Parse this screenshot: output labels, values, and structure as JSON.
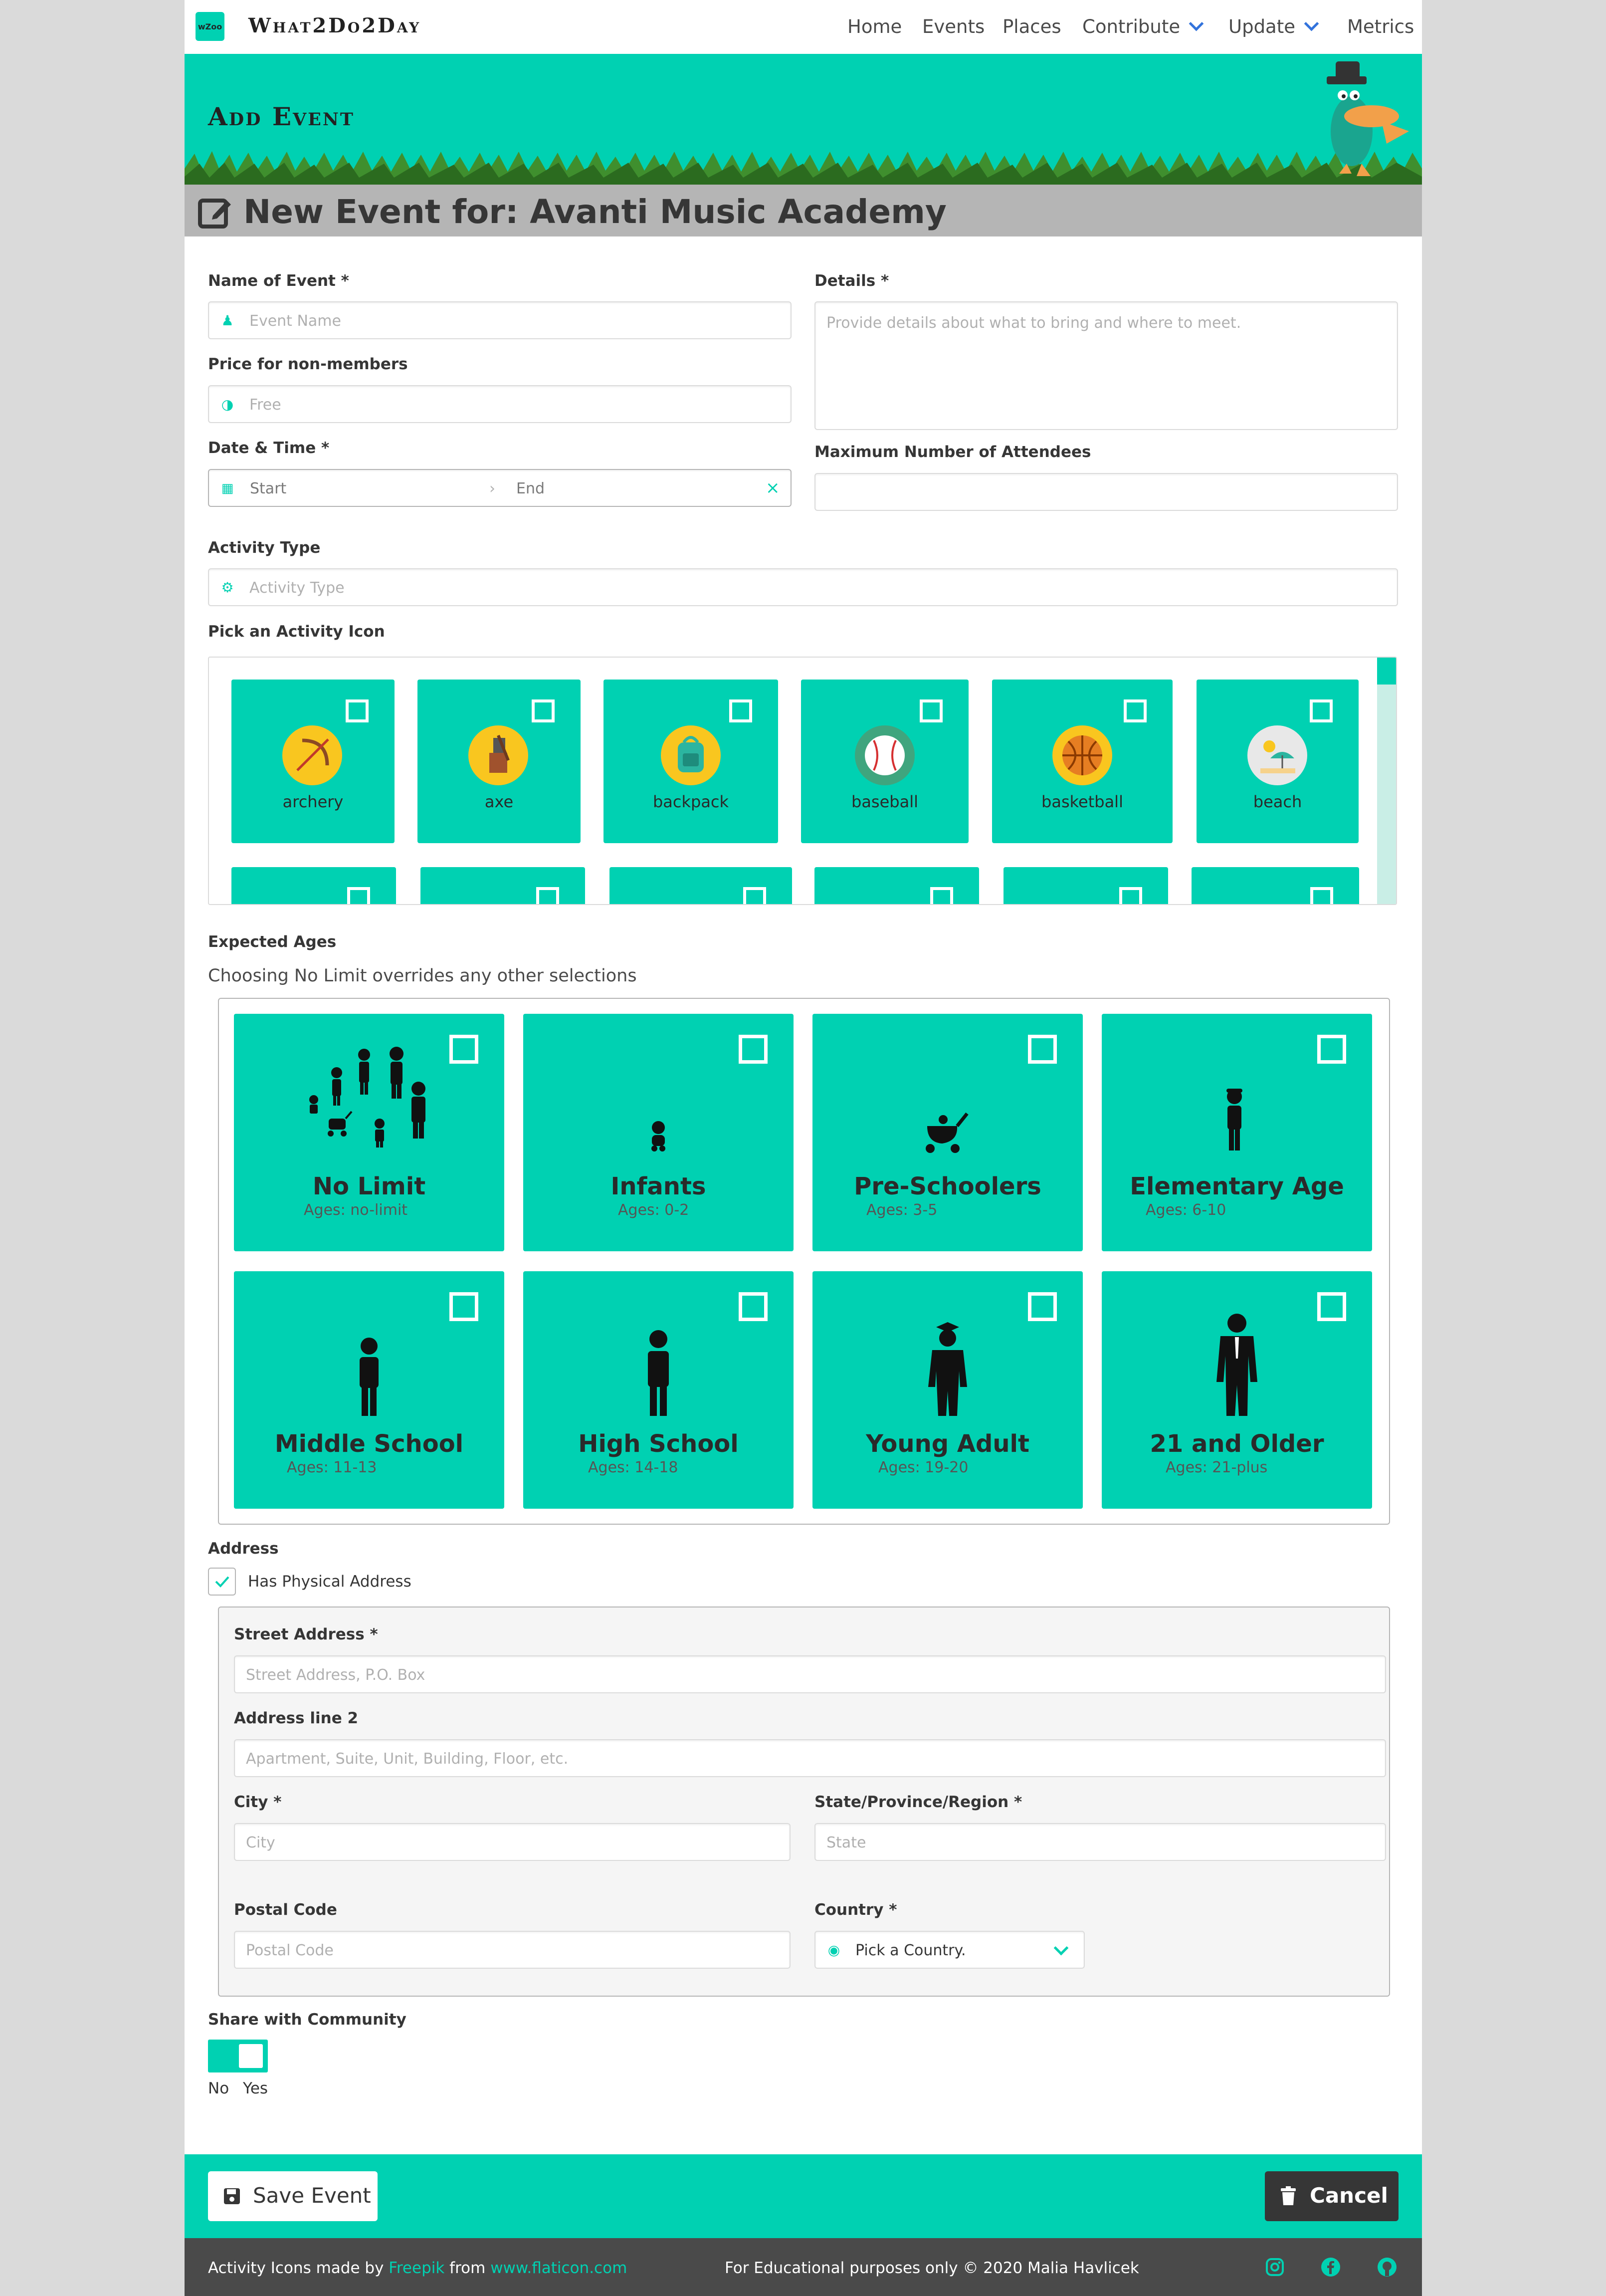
{
  "nav": {
    "logo_text": "wZoo",
    "brand": "What2Do2Day",
    "items": [
      "Home",
      "Events",
      "Places",
      "Contribute",
      "Update",
      "Metrics"
    ]
  },
  "hero": {
    "title": "Add Event"
  },
  "subhead": {
    "title": "New Event for: Avanti Music Academy"
  },
  "form": {
    "name_label": "Name of Event *",
    "name_placeholder": "Event Name",
    "details_label": "Details *",
    "details_placeholder": "Provide details about what to bring and where to meet.",
    "price_label": "Price for non-members",
    "price_placeholder": "Free",
    "datetime_label": "Date & Time *",
    "start_placeholder": "Start",
    "end_placeholder": "End",
    "max_label": "Maximum Number of Attendees",
    "activity_type_label": "Activity Type",
    "activity_type_placeholder": "Activity Type",
    "icon_label": "Pick an Activity Icon",
    "activity_icons": [
      {
        "label": "archery",
        "icon": "archery-icon",
        "color": "#f9c61f"
      },
      {
        "label": "axe",
        "icon": "axe-icon",
        "color": "#f9c61f"
      },
      {
        "label": "backpack",
        "icon": "backpack-icon",
        "color": "#f9c61f"
      },
      {
        "label": "baseball",
        "icon": "baseball-icon",
        "color": "#3fa57e"
      },
      {
        "label": "basketball",
        "icon": "basketball-icon",
        "color": "#f9c61f"
      },
      {
        "label": "beach",
        "icon": "beach-icon",
        "color": "#e8e8e8"
      }
    ],
    "ages_label": "Expected Ages",
    "ages_help": "Choosing No Limit overrides any other selections",
    "ages": [
      {
        "title": "No Limit",
        "sub": "Ages: no-limit",
        "icon": "group-icon"
      },
      {
        "title": "Infants",
        "sub": "Ages: 0-2",
        "icon": "baby-icon"
      },
      {
        "title": "Pre-Schoolers",
        "sub": "Ages: 3-5",
        "icon": "stroller-icon"
      },
      {
        "title": "Elementary Age",
        "sub": "Ages: 6-10",
        "icon": "child-icon"
      },
      {
        "title": "Middle School",
        "sub": "Ages: 11-13",
        "icon": "preteen-icon"
      },
      {
        "title": "High School",
        "sub": "Ages: 14-18",
        "icon": "teen-icon"
      },
      {
        "title": "Young Adult",
        "sub": "Ages: 19-20",
        "icon": "graduate-icon"
      },
      {
        "title": "21 and Older",
        "sub": "Ages: 21-plus",
        "icon": "adult-icon"
      }
    ],
    "address_label": "Address",
    "has_address": "Has Physical Address",
    "street_label": "Street Address *",
    "street_placeholder": "Street Address, P.O. Box",
    "line2_label": "Address line 2",
    "line2_placeholder": "Apartment, Suite, Unit, Building, Floor, etc.",
    "city_label": "City *",
    "city_placeholder": "City",
    "state_label": "State/Province/Region *",
    "state_placeholder": "State",
    "postal_label": "Postal Code",
    "postal_placeholder": "Postal Code",
    "country_label": "Country *",
    "country_value": "Pick a Country.",
    "share_label": "Share with Community",
    "share_no": "No",
    "share_yes": "Yes"
  },
  "actions": {
    "save": "Save Event",
    "cancel": "Cancel"
  },
  "footer": {
    "credit_prefix": "Activity Icons made by",
    "credit_author": "Freepik",
    "credit_from": "from",
    "credit_site": "www.flaticon.com",
    "notice": "For Educational purposes only © 2020 Malia Havlicek"
  },
  "colors": {
    "accent": "#00d1b2",
    "dark": "#363636",
    "link": "#3273dc"
  }
}
